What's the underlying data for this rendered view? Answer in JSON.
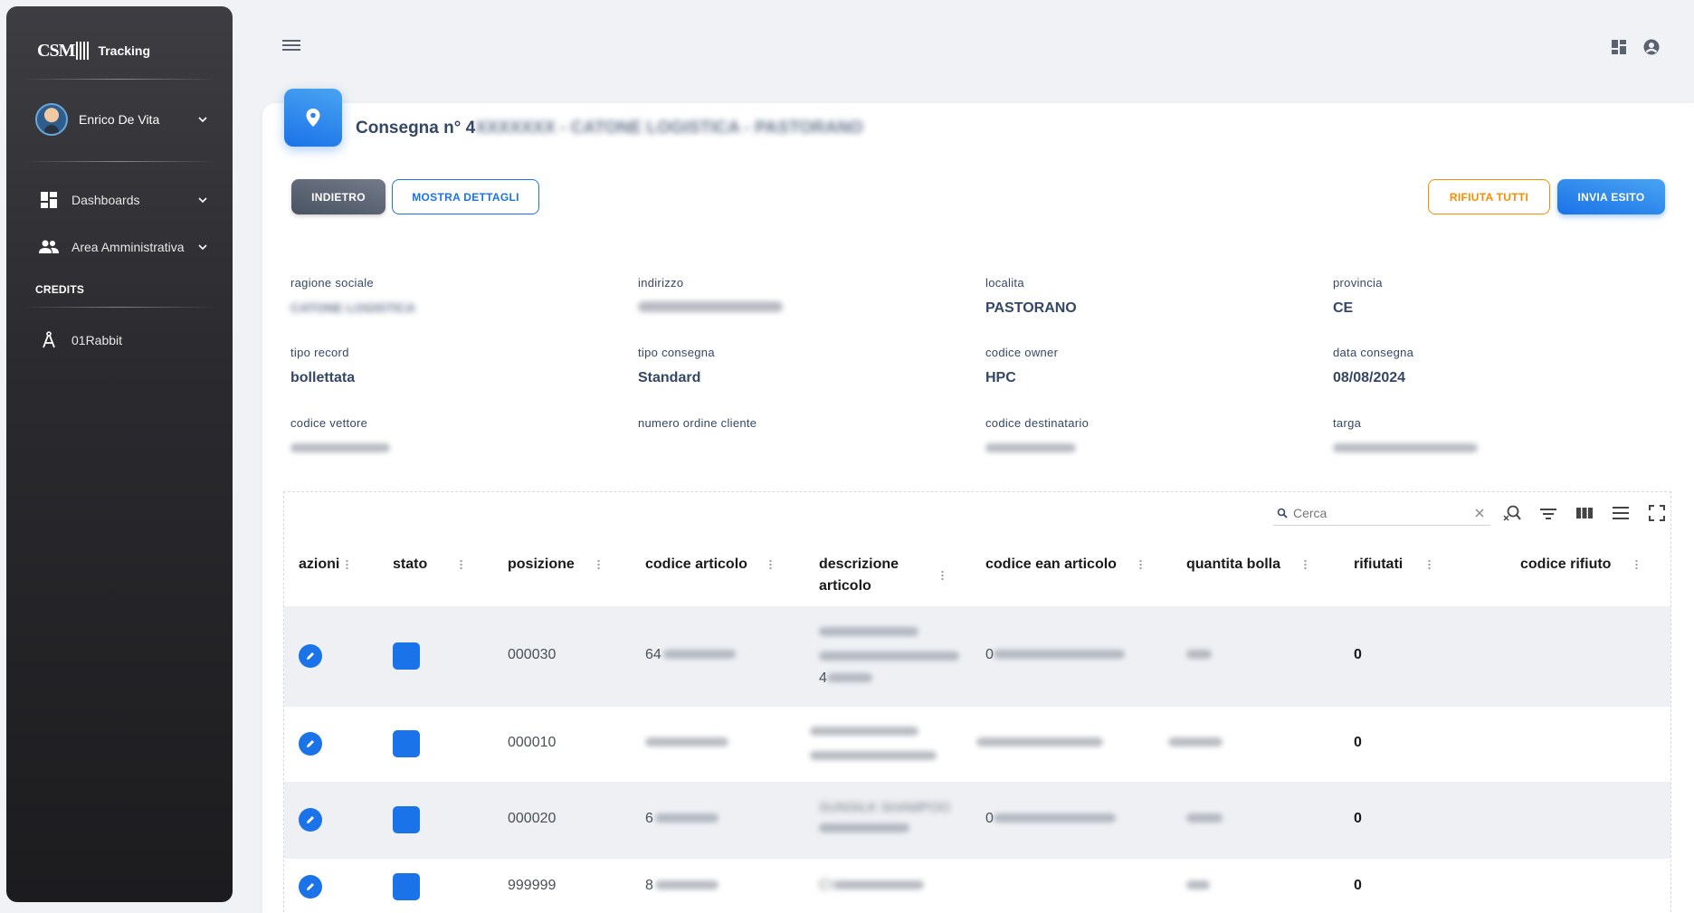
{
  "sidebar": {
    "brand_logo": "CSM",
    "brand_name": "Tracking",
    "user_name": "Enrico De Vita",
    "nav": [
      {
        "label": "Dashboards",
        "icon": "dashboard-icon"
      },
      {
        "label": "Area Amministrativa",
        "icon": "people-icon"
      }
    ],
    "credits_title": "CREDITS",
    "credits_item": "01Rabbit"
  },
  "header": {
    "title_prefix": "Consegna n° 4",
    "title_blurred": "XXXXXXX - CA",
    "title_blurred2": "TONE LOGISTICA - PASTORANO"
  },
  "buttons": {
    "back": "INDIETRO",
    "details": "MOSTRA DETTAGLI",
    "reject_all": "RIFIUTA TUTTI",
    "send": "INVIA ESITO"
  },
  "fields": {
    "ragione_sociale": {
      "label": "ragione sociale",
      "value": "CATONE LOGISTICA"
    },
    "indirizzo": {
      "label": "indirizzo",
      "value": ""
    },
    "localita": {
      "label": "localita",
      "value": "PASTORANO"
    },
    "provincia": {
      "label": "provincia",
      "value": "CE"
    },
    "tipo_record": {
      "label": "tipo record",
      "value": "bollettata"
    },
    "tipo_consegna": {
      "label": "tipo consegna",
      "value": "Standard"
    },
    "codice_owner": {
      "label": "codice owner",
      "value": "HPC"
    },
    "data_consegna": {
      "label": "data consegna",
      "value": "08/08/2024"
    },
    "codice_vettore": {
      "label": "codice vettore",
      "value": ""
    },
    "numero_ordine": {
      "label": "numero ordine cliente",
      "value": ""
    },
    "codice_destinatario": {
      "label": "codice destinatario",
      "value": ""
    },
    "targa": {
      "label": "targa",
      "value": ""
    }
  },
  "table": {
    "search_placeholder": "Cerca",
    "columns": [
      "azioni",
      "stato",
      "posizione",
      "codice articolo",
      "descrizione articolo",
      "codice ean articolo",
      "quantita bolla",
      "rifiutati",
      "codice rifiuto"
    ],
    "column_descrizione_line1": "descrizione",
    "column_descrizione_line2": "articolo",
    "rows": [
      {
        "posizione": "000030",
        "codice_articolo_start": "64",
        "descrizione_tail": "4",
        "ean_start": "0",
        "rifiutati": "0"
      },
      {
        "posizione": "000010",
        "codice_articolo_start": "",
        "descrizione_tail": "",
        "ean_start": "",
        "rifiutati": "0"
      },
      {
        "posizione": "000020",
        "codice_articolo_start": "6",
        "descrizione_text": "SUNSILK SHAMPOO",
        "ean_start": "0",
        "rifiutati": "0"
      },
      {
        "posizione": "999999",
        "codice_articolo_start": "8",
        "descrizione_text": "CI",
        "ean_start": "",
        "rifiutati": "0"
      }
    ]
  },
  "colors": {
    "primary": "#1a73e8",
    "warning": "#fb8c00",
    "dark": "#344767"
  }
}
